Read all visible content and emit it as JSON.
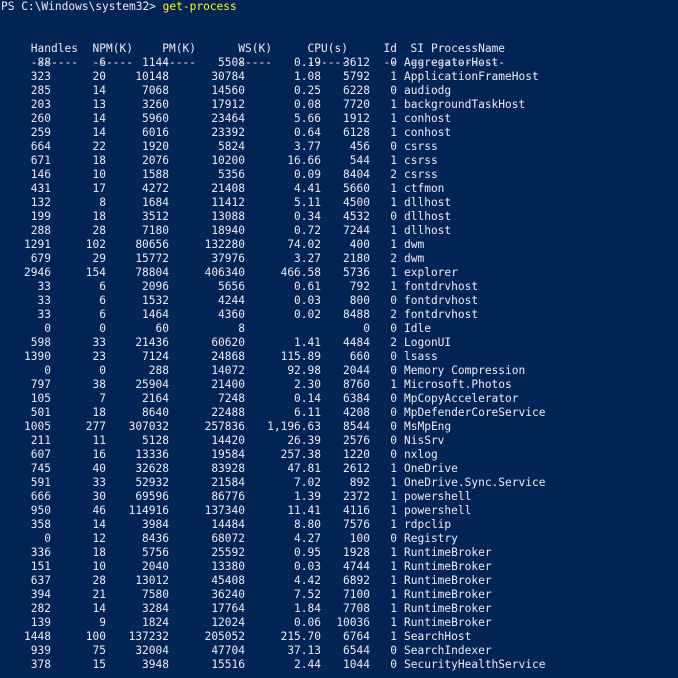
{
  "prompt": {
    "path": "PS C:\\Windows\\system32> ",
    "command": "get-process"
  },
  "headers": [
    "Handles",
    "NPM(K)",
    "PM(K)",
    "WS(K)",
    "CPU(s)",
    "Id",
    "SI",
    "ProcessName"
  ],
  "separators": [
    "-------",
    "------",
    "-----",
    "-----",
    "------",
    "--",
    "--",
    "-----------"
  ],
  "rows": [
    [
      "88",
      "6",
      "1144",
      "5508",
      "0.19",
      "3612",
      "0",
      "AggregatorHost"
    ],
    [
      "323",
      "20",
      "10148",
      "30784",
      "1.08",
      "5792",
      "1",
      "ApplicationFrameHost"
    ],
    [
      "285",
      "14",
      "7068",
      "14560",
      "0.25",
      "6228",
      "0",
      "audiodg"
    ],
    [
      "203",
      "13",
      "3260",
      "17912",
      "0.08",
      "7720",
      "1",
      "backgroundTaskHost"
    ],
    [
      "260",
      "14",
      "5960",
      "23464",
      "5.66",
      "1912",
      "1",
      "conhost"
    ],
    [
      "259",
      "14",
      "6016",
      "23392",
      "0.64",
      "6128",
      "1",
      "conhost"
    ],
    [
      "664",
      "22",
      "1920",
      "5824",
      "3.77",
      "456",
      "0",
      "csrss"
    ],
    [
      "671",
      "18",
      "2076",
      "10200",
      "16.66",
      "544",
      "1",
      "csrss"
    ],
    [
      "146",
      "10",
      "1588",
      "5356",
      "0.09",
      "8404",
      "2",
      "csrss"
    ],
    [
      "431",
      "17",
      "4272",
      "21408",
      "4.41",
      "5660",
      "1",
      "ctfmon"
    ],
    [
      "132",
      "8",
      "1684",
      "11412",
      "5.11",
      "4500",
      "1",
      "dllhost"
    ],
    [
      "199",
      "18",
      "3512",
      "13088",
      "0.34",
      "4532",
      "0",
      "dllhost"
    ],
    [
      "288",
      "28",
      "7180",
      "18940",
      "0.72",
      "7244",
      "1",
      "dllhost"
    ],
    [
      "1291",
      "102",
      "80656",
      "132280",
      "74.02",
      "400",
      "1",
      "dwm"
    ],
    [
      "679",
      "29",
      "15772",
      "37976",
      "3.27",
      "2180",
      "2",
      "dwm"
    ],
    [
      "2946",
      "154",
      "78804",
      "406340",
      "466.58",
      "5736",
      "1",
      "explorer"
    ],
    [
      "33",
      "6",
      "2096",
      "5656",
      "0.61",
      "792",
      "1",
      "fontdrvhost"
    ],
    [
      "33",
      "6",
      "1532",
      "4244",
      "0.03",
      "800",
      "0",
      "fontdrvhost"
    ],
    [
      "33",
      "6",
      "1464",
      "4360",
      "0.02",
      "8488",
      "2",
      "fontdrvhost"
    ],
    [
      "0",
      "0",
      "60",
      "8",
      "",
      "0",
      "0",
      "Idle"
    ],
    [
      "598",
      "33",
      "21436",
      "60620",
      "1.41",
      "4484",
      "2",
      "LogonUI"
    ],
    [
      "1390",
      "23",
      "7124",
      "24868",
      "115.89",
      "660",
      "0",
      "lsass"
    ],
    [
      "0",
      "0",
      "288",
      "14072",
      "92.98",
      "2044",
      "0",
      "Memory Compression"
    ],
    [
      "797",
      "38",
      "25904",
      "21400",
      "2.30",
      "8760",
      "1",
      "Microsoft.Photos"
    ],
    [
      "105",
      "7",
      "2164",
      "7248",
      "0.14",
      "6384",
      "0",
      "MpCopyAccelerator"
    ],
    [
      "501",
      "18",
      "8640",
      "22488",
      "6.11",
      "4208",
      "0",
      "MpDefenderCoreService"
    ],
    [
      "1005",
      "277",
      "307032",
      "257836",
      "1,196.63",
      "8544",
      "0",
      "MsMpEng"
    ],
    [
      "211",
      "11",
      "5128",
      "14420",
      "26.39",
      "2576",
      "0",
      "NisSrv"
    ],
    [
      "607",
      "16",
      "13336",
      "19584",
      "257.38",
      "1220",
      "0",
      "nxlog"
    ],
    [
      "745",
      "40",
      "32628",
      "83928",
      "47.81",
      "2612",
      "1",
      "OneDrive"
    ],
    [
      "591",
      "33",
      "52932",
      "21584",
      "7.02",
      "892",
      "1",
      "OneDrive.Sync.Service"
    ],
    [
      "666",
      "30",
      "69596",
      "86776",
      "1.39",
      "2372",
      "1",
      "powershell"
    ],
    [
      "950",
      "46",
      "114916",
      "137340",
      "11.41",
      "4116",
      "1",
      "powershell"
    ],
    [
      "358",
      "14",
      "3984",
      "14484",
      "8.80",
      "7576",
      "1",
      "rdpclip"
    ],
    [
      "0",
      "12",
      "8436",
      "68072",
      "4.27",
      "100",
      "0",
      "Registry"
    ],
    [
      "336",
      "18",
      "5756",
      "25592",
      "0.95",
      "1928",
      "1",
      "RuntimeBroker"
    ],
    [
      "151",
      "10",
      "2040",
      "13380",
      "0.03",
      "4744",
      "1",
      "RuntimeBroker"
    ],
    [
      "637",
      "28",
      "13012",
      "45408",
      "4.42",
      "6892",
      "1",
      "RuntimeBroker"
    ],
    [
      "394",
      "21",
      "7580",
      "36240",
      "7.52",
      "7100",
      "1",
      "RuntimeBroker"
    ],
    [
      "282",
      "14",
      "3284",
      "17764",
      "1.84",
      "7708",
      "1",
      "RuntimeBroker"
    ],
    [
      "139",
      "9",
      "1824",
      "12024",
      "0.06",
      "10036",
      "1",
      "RuntimeBroker"
    ],
    [
      "1448",
      "100",
      "137232",
      "205052",
      "215.70",
      "6764",
      "1",
      "SearchHost"
    ],
    [
      "939",
      "75",
      "32004",
      "47704",
      "37.13",
      "6544",
      "0",
      "SearchIndexer"
    ],
    [
      "378",
      "15",
      "3948",
      "15516",
      "2.44",
      "1044",
      "0",
      "SecurityHealthService"
    ]
  ],
  "colors": {
    "background": "#012456",
    "text": "#eeedf0",
    "command": "#ffff00"
  }
}
